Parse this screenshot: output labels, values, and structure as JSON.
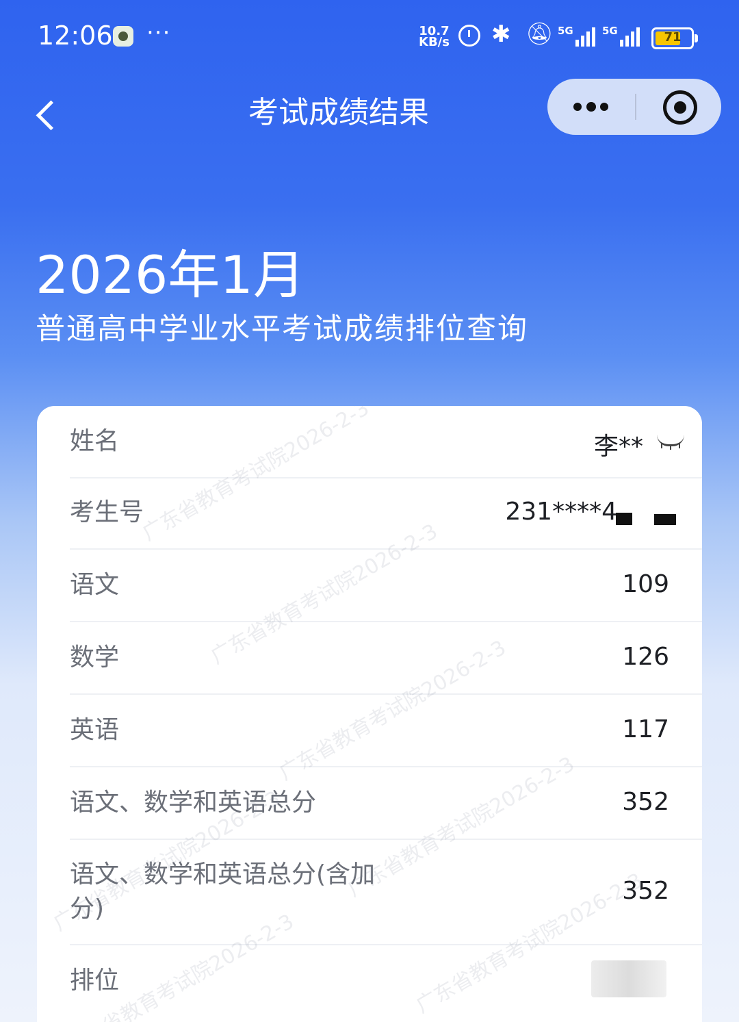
{
  "status_bar": {
    "time": "12:06",
    "more": "···",
    "net_speed_value": "10.7",
    "net_speed_unit": "KB/s",
    "sim1_label": "5G",
    "sim2_label": "5G",
    "battery_percent": "71",
    "battery_level": 71
  },
  "nav": {
    "title": "考试成绩结果"
  },
  "hero": {
    "year_month": "2026年1月",
    "subtitle": "普通高中学业水平考试成绩排位查询"
  },
  "rows": [
    {
      "label": "姓名",
      "value": "李**"
    },
    {
      "label": "考生号",
      "value": "231****4"
    },
    {
      "label": "语文",
      "value": "109"
    },
    {
      "label": "数学",
      "value": "126"
    },
    {
      "label": "英语",
      "value": "117"
    },
    {
      "label": "语文、数学和英语总分",
      "value": "352"
    },
    {
      "label": "语文、数学和英语总分(含加分)",
      "value": "352"
    },
    {
      "label": "排位",
      "value": ""
    }
  ],
  "watermark_text": "广东省教育考试院2026-2-3"
}
